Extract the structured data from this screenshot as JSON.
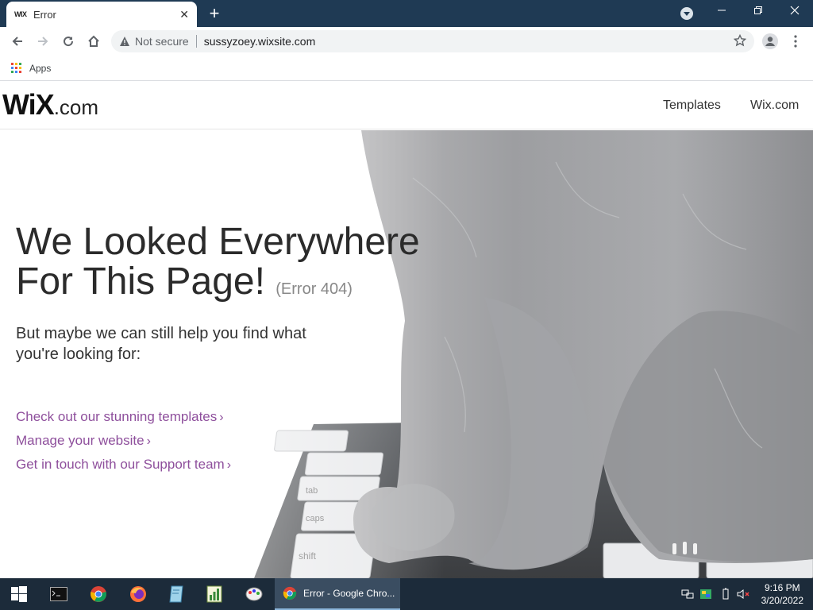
{
  "browser": {
    "tab_title": "Error",
    "tab_favicon": "WIX",
    "security_label": "Not secure",
    "url": "sussyzoey.wixsite.com",
    "bookmarks": {
      "apps_label": "Apps"
    }
  },
  "site": {
    "logo_main": "WiX",
    "logo_suffix": ".com",
    "nav": [
      {
        "label": "Templates"
      },
      {
        "label": "Wix.com"
      }
    ],
    "heading_line1": "We Looked Everywhere",
    "heading_line2": "For This Page!",
    "error_code": "(Error 404)",
    "subtext": "But maybe we can still help you find what you're looking for:",
    "links": [
      {
        "label": "Check out our stunning templates"
      },
      {
        "label": "Manage your website"
      },
      {
        "label": "Get in touch with our Support team"
      }
    ],
    "keyboard_keys": [
      "tab",
      "caps",
      "shift"
    ],
    "link_color": "#8e4f9c"
  },
  "taskbar": {
    "active_window": "Error - Google Chro...",
    "time": "9:16 PM",
    "date": "3/20/2022"
  },
  "icons": [
    "back-icon",
    "forward-icon",
    "reload-icon",
    "home-icon",
    "warning-icon",
    "star-icon",
    "profile-icon",
    "menu-icon",
    "apps-icon",
    "windows-start-icon",
    "terminal-icon",
    "chrome-icon",
    "firefox-icon",
    "notepad-icon",
    "chart-app-icon",
    "paint-icon",
    "network-icon",
    "volume-muted-icon"
  ]
}
